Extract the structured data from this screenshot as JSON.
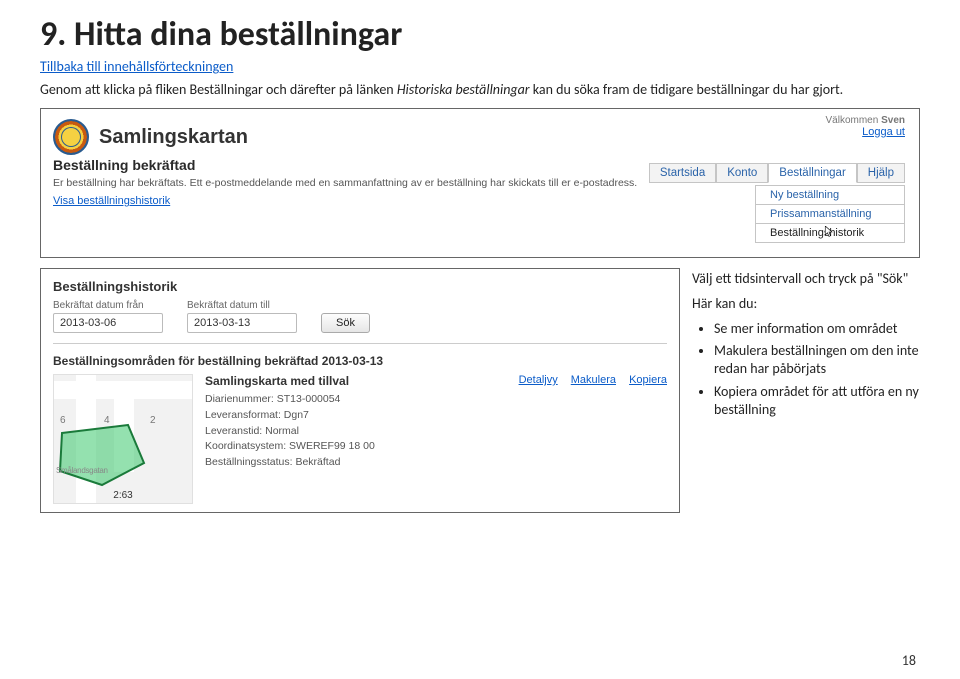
{
  "page": {
    "heading": "9. Hitta dina beställningar",
    "toc_link": "Tillbaka till innehållsförteckningen",
    "intro_before": "Genom att klicka på fliken Beställningar och därefter på länken ",
    "intro_italic": "Historiska beställningar",
    "intro_after": " kan du söka fram de tidigare beställningar du har gjort.",
    "page_number": "18"
  },
  "screenshot1": {
    "brand": "Samlingskartan",
    "welcome_prefix": "Välkommen",
    "welcome_user": "Sven",
    "logout": "Logga ut",
    "nav": [
      "Startsida",
      "Konto",
      "Beställningar",
      "Hjälp"
    ],
    "subnav": [
      "Ny beställning",
      "Prissammanställning",
      "Beställningshistorik"
    ],
    "section_title": "Beställning bekräftad",
    "section_desc": "Er beställning har bekräftats. Ett e-postmeddelande med en sammanfattning av er beställning har skickats till er e-postadress.",
    "show_history": "Visa beställningshistorik"
  },
  "screenshot2": {
    "history_title": "Beställningshistorik",
    "date_from_label": "Bekräftat datum från",
    "date_to_label": "Bekräftat datum till",
    "date_from": "2013-03-06",
    "date_to": "2013-03-13",
    "search": "Sök",
    "sub_title": "Beställningsområden för beställning bekräftad 2013-03-13",
    "map": {
      "n6": "6",
      "n4": "4",
      "n2": "2",
      "street": "Smålandsgatan",
      "scale": "2:63"
    },
    "order_name": "Samlingskarta med tillval",
    "meta": [
      "Diarienummer: ST13-000054",
      "Leveransformat: Dgn7",
      "Leveranstid: Normal",
      "Koordinatsystem: SWEREF99 18 00",
      "Beställningsstatus: Bekräftad"
    ],
    "actions": [
      "Detaljvy",
      "Makulera",
      "Kopiera"
    ]
  },
  "aside": {
    "line1": "Välj ett tidsintervall och tryck på \"Sök\"",
    "line2": "Här kan du:",
    "bullets": [
      "Se mer information om området",
      "Makulera beställningen om den inte redan har påbörjats",
      "Kopiera området för att utföra en ny beställning"
    ]
  }
}
